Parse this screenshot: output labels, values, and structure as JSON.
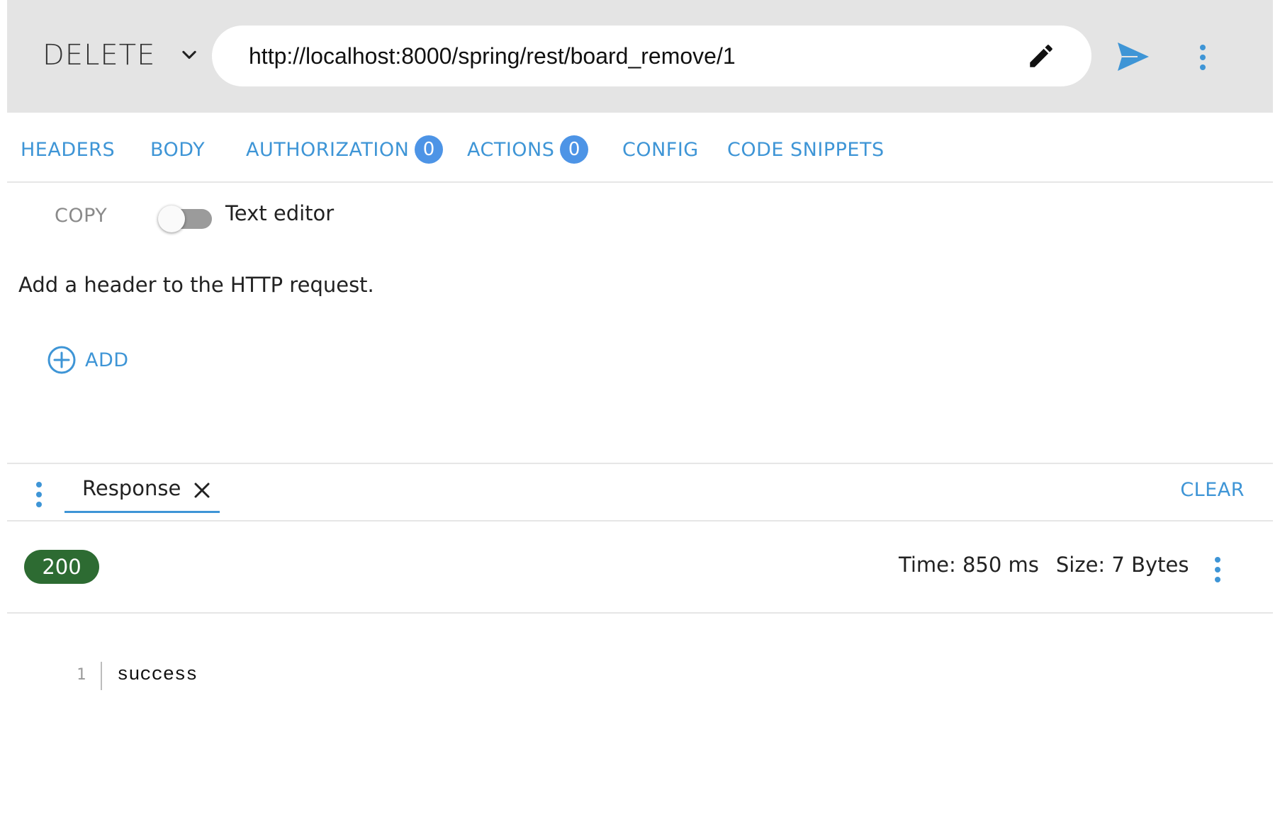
{
  "request": {
    "method": "DELETE",
    "url": "http://localhost:8000/spring/rest/board_remove/1"
  },
  "tabs": [
    {
      "label": "HEADERS"
    },
    {
      "label": "BODY"
    },
    {
      "label": "AUTHORIZATION",
      "badge": "0"
    },
    {
      "label": "ACTIONS",
      "badge": "0"
    },
    {
      "label": "CONFIG"
    },
    {
      "label": "CODE SNIPPETS"
    }
  ],
  "headers_panel": {
    "copy_label": "COPY",
    "toggle_label": "Text editor",
    "toggle_on": false,
    "help_text": "Add a header to the HTTP request.",
    "add_label": "ADD"
  },
  "response": {
    "tab_label": "Response",
    "clear_label": "CLEAR",
    "status_code": "200",
    "time_text": "Time: 850 ms",
    "size_text": "Size: 7 Bytes",
    "body_lines": [
      {
        "number": "1",
        "text": "success"
      }
    ]
  },
  "colors": {
    "accent": "#3e95d6",
    "badge": "#4d94e6",
    "status_ok": "#2d6b32",
    "request_bar_bg": "#e4e4e4"
  },
  "icons": {
    "method_dropdown": "chevron-down-icon",
    "edit": "pencil-icon",
    "send": "send-icon",
    "more": "more-vertical-icon",
    "add": "plus-circle-icon",
    "close": "close-icon"
  }
}
